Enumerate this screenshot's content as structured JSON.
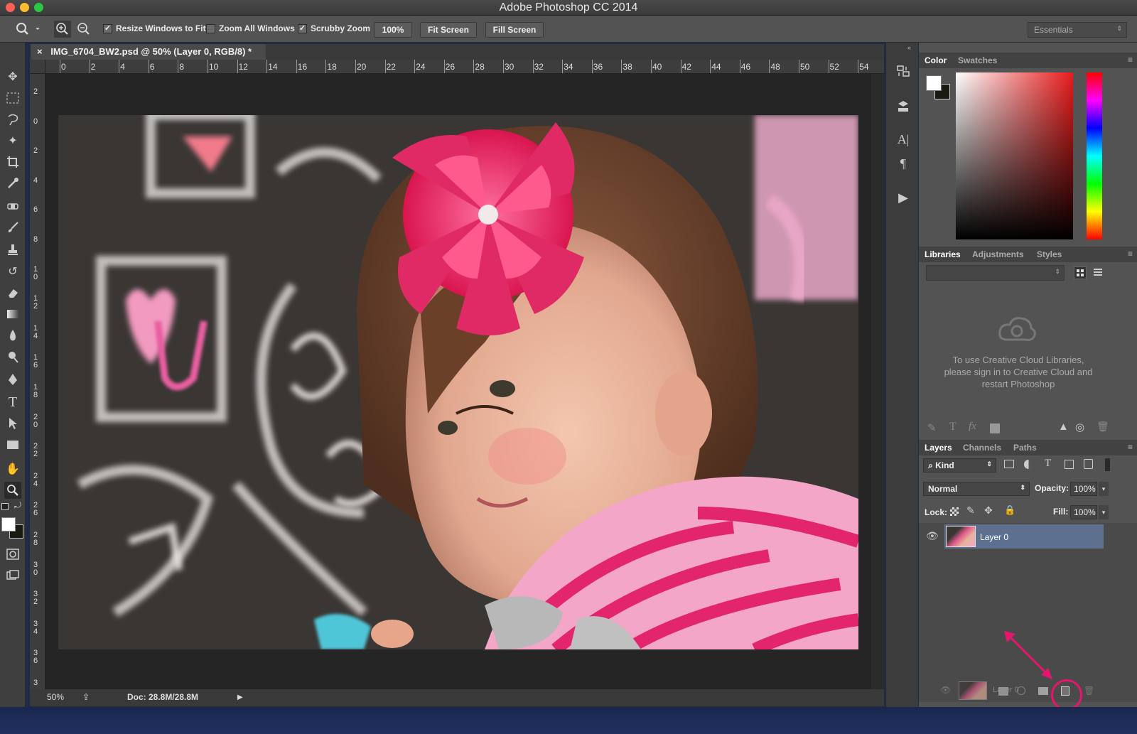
{
  "app": {
    "title": "Adobe Photoshop CC 2014"
  },
  "options_bar": {
    "resize_windows_label": "Resize Windows to Fit",
    "resize_windows_checked": true,
    "zoom_all_label": "Zoom All Windows",
    "zoom_all_checked": false,
    "scrubby_zoom_label": "Scrubby Zoom",
    "scrubby_zoom_checked": true,
    "zoom_value": "100%",
    "fit_screen_label": "Fit Screen",
    "fill_screen_label": "Fill Screen",
    "workspace": "Essentials"
  },
  "document": {
    "tab_title": "IMG_6704_BW2.psd @ 50% (Layer 0, RGB/8) *",
    "close_glyph": "×",
    "ruler_h": [
      "0",
      "2",
      "4",
      "6",
      "8",
      "10",
      "12",
      "14",
      "16",
      "18",
      "20",
      "22",
      "24",
      "26",
      "28",
      "30",
      "32",
      "34",
      "36",
      "38",
      "40",
      "42",
      "44",
      "46",
      "48",
      "50",
      "52",
      "54"
    ],
    "ruler_v": [
      "2",
      "0",
      "2",
      "4",
      "6",
      "8",
      "1\n0",
      "1\n2",
      "1\n4",
      "1\n6",
      "1\n8",
      "2\n0",
      "2\n2",
      "2\n4",
      "2\n6",
      "2\n8",
      "3\n0",
      "3\n2",
      "3\n4",
      "3\n6",
      "3"
    ]
  },
  "status": {
    "zoom": "50%",
    "doc_size": "Doc: 28.8M/28.8M"
  },
  "color_panel": {
    "tabs": [
      "Color",
      "Swatches"
    ],
    "fg_color": "#ffffff",
    "bg_color": "#1a1a10"
  },
  "libraries_panel": {
    "tabs": [
      "Libraries",
      "Adjustments",
      "Styles"
    ],
    "message": "To use Creative Cloud Libraries, please sign in to Creative Cloud and restart Photoshop"
  },
  "layers_panel": {
    "tabs": [
      "Layers",
      "Channels",
      "Paths"
    ],
    "filter_kind": "Kind",
    "blend_mode": "Normal",
    "opacity_label": "Opacity:",
    "opacity_value": "100%",
    "lock_label": "Lock:",
    "fill_label": "Fill:",
    "fill_value": "100%",
    "layers": [
      {
        "name": "Layer 0",
        "visible": true,
        "selected": true
      }
    ],
    "ghost_layer_name": "Layer 0"
  },
  "annotation": {
    "color": "#e8156e"
  }
}
